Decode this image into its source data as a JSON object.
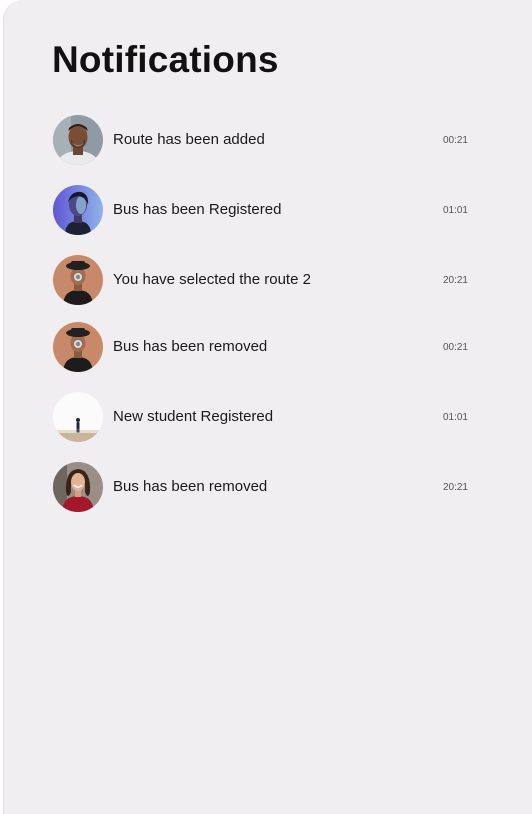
{
  "header": {
    "title": "Notifications"
  },
  "notifications": [
    {
      "message": "Route has been added",
      "time": "00:21",
      "avatar_icon": "man-portrait-avatar"
    },
    {
      "message": "Bus has been Registered",
      "time": "01:01",
      "avatar_icon": "woman-neon-portrait-avatar"
    },
    {
      "message": "You have selected the route 2",
      "time": "20:21",
      "avatar_icon": "man-hat-portrait-avatar"
    },
    {
      "message": "Bus has been removed",
      "time": "00:21",
      "avatar_icon": "man-hat-portrait-avatar"
    },
    {
      "message": "New student Registered",
      "time": "01:01",
      "avatar_icon": "person-silhouette-avatar"
    },
    {
      "message": "Bus has been removed",
      "time": "20:21",
      "avatar_icon": "woman-red-shirt-avatar"
    }
  ],
  "colors": {
    "panel_background": "#f1eef1",
    "title": "#111111",
    "text": "#1a1a1a",
    "time": "#555555"
  }
}
